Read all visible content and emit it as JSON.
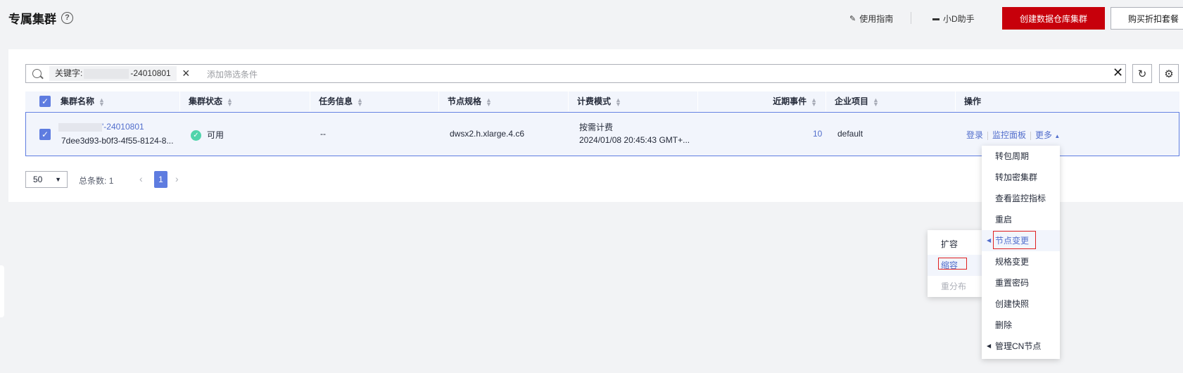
{
  "header": {
    "title": "专属集群",
    "links": [
      "使用指南",
      "小D助手"
    ],
    "primary_button": "创建数据仓库集群",
    "secondary_button": "购买折扣套餐"
  },
  "search": {
    "tag_key": "关键字:",
    "tag_value": "-24010801",
    "placeholder": "添加筛选条件"
  },
  "table": {
    "columns": [
      "集群名称",
      "集群状态",
      "任务信息",
      "节点规格",
      "计费模式",
      "近期事件",
      "企业项目",
      "操作"
    ],
    "row": {
      "name": "'-24010801",
      "id": "7dee3d93-b0f3-4f55-8124-8...",
      "status": "可用",
      "task": "--",
      "spec": "dwsx2.h.xlarge.4.c6",
      "billing_mode": "按需计费",
      "billing_time": "2024/01/08 20:45:43 GMT+...",
      "events": "10",
      "project": "default",
      "ops": [
        "登录",
        "监控面板",
        "更多"
      ]
    }
  },
  "pagination": {
    "page_size": "50",
    "total_label": "总条数:",
    "total": "1",
    "current_page": "1"
  },
  "more_menu": [
    "转包周期",
    "转加密集群",
    "查看监控指标",
    "重启",
    "节点变更",
    "规格变更",
    "重置密码",
    "创建快照",
    "删除",
    "管理CN节点"
  ],
  "node_submenu": [
    "扩容",
    "缩容",
    "重分布"
  ],
  "colors": {
    "primary_red": "#c7000b",
    "link_blue": "#526ecc",
    "accent_blue": "#5e7ce0",
    "status_green": "#50d4ab",
    "highlight_red": "#e02020"
  }
}
